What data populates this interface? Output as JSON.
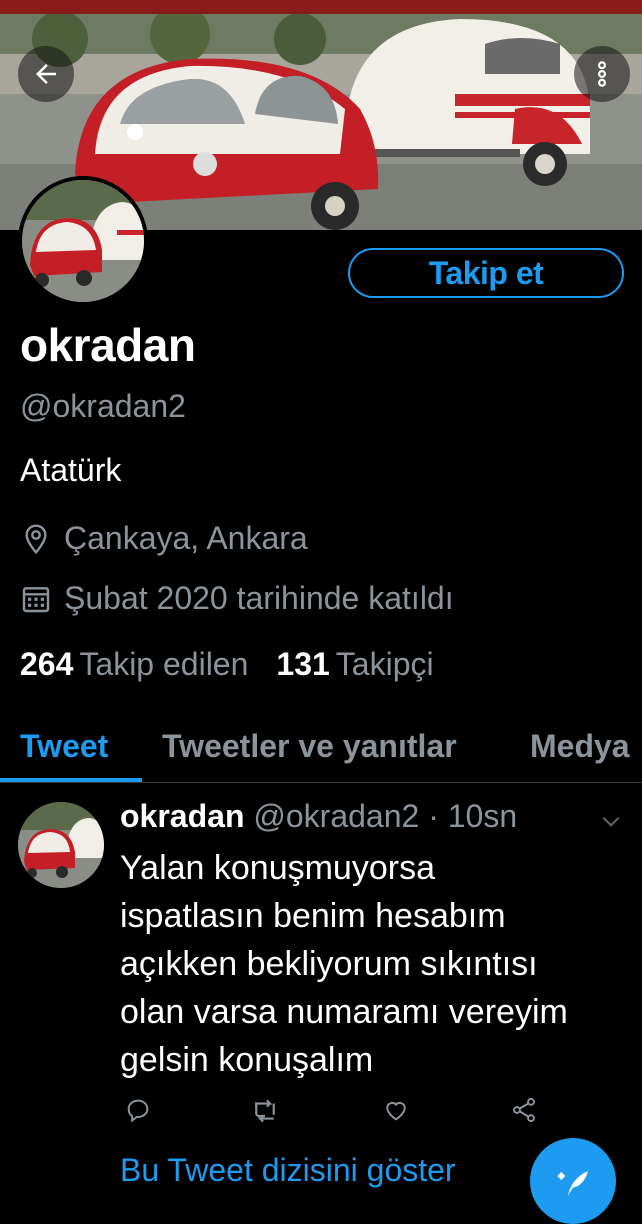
{
  "theme": {
    "background": "#000000",
    "accent": "#1d9bf0",
    "muted_text": "#8b949b",
    "top_bar": "#8b1a1a"
  },
  "header": {
    "banner_image": "red-bubble-car-with-trailer",
    "back_icon": "arrow-left-icon",
    "more_icon": "vertical-dots-icon"
  },
  "profile": {
    "avatar": "red-bubble-car-with-trailer",
    "follow_label": "Takip et",
    "display_name": "okradan",
    "handle": "@okradan2",
    "bio": "Atatürk",
    "location": "Çankaya, Ankara",
    "location_icon": "location-pin-icon",
    "joined": "Şubat 2020 tarihinde katıldı",
    "joined_icon": "calendar-icon",
    "following_count": "264",
    "following_label": "Takip edilen",
    "followers_count": "131",
    "followers_label": "Takipçi"
  },
  "tabs": [
    {
      "label": "Tweet",
      "active": true
    },
    {
      "label": "Tweetler ve yanıtlar",
      "active": false
    },
    {
      "label": "Medya",
      "active": false
    }
  ],
  "tweet": {
    "author_name": "okradan",
    "author_handle": "@okradan2",
    "separator": "·",
    "time": "10sn",
    "text": "Yalan konuşmuyorsa\nispatlasın benim hesabım\naçıkken bekliyorum sıkıntısı\nolan varsa numaramı vereyim\ngelsin konuşalım",
    "actions": [
      "reply-icon",
      "retweet-icon",
      "like-icon",
      "share-icon"
    ],
    "thread_link": "Bu Tweet dizisini göster"
  },
  "fab": {
    "icon": "compose-tweet-icon"
  }
}
